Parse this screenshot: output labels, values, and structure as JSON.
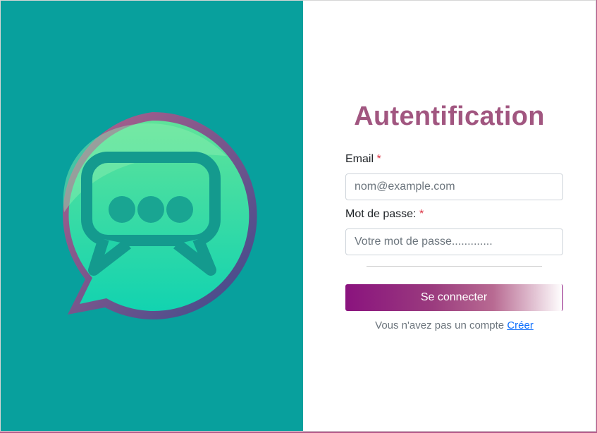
{
  "login": {
    "title": "Autentification",
    "email_label": "Email",
    "email_required": "*",
    "email_placeholder": "nom@example.com",
    "password_label": "Mot de passe:",
    "password_required": "*",
    "password_placeholder": "Votre mot de passe.............",
    "submit_label": "Se connecter",
    "signup_prompt": "Vous n'avez pas un compte",
    "signup_link": "Créer"
  },
  "logo": {
    "icon": "chat-bubble-icon"
  },
  "colors": {
    "left_panel": "#08a09d",
    "title": "#a15680",
    "button_start": "#8a137e",
    "required": "#dc3545",
    "link": "#0d6efd"
  }
}
